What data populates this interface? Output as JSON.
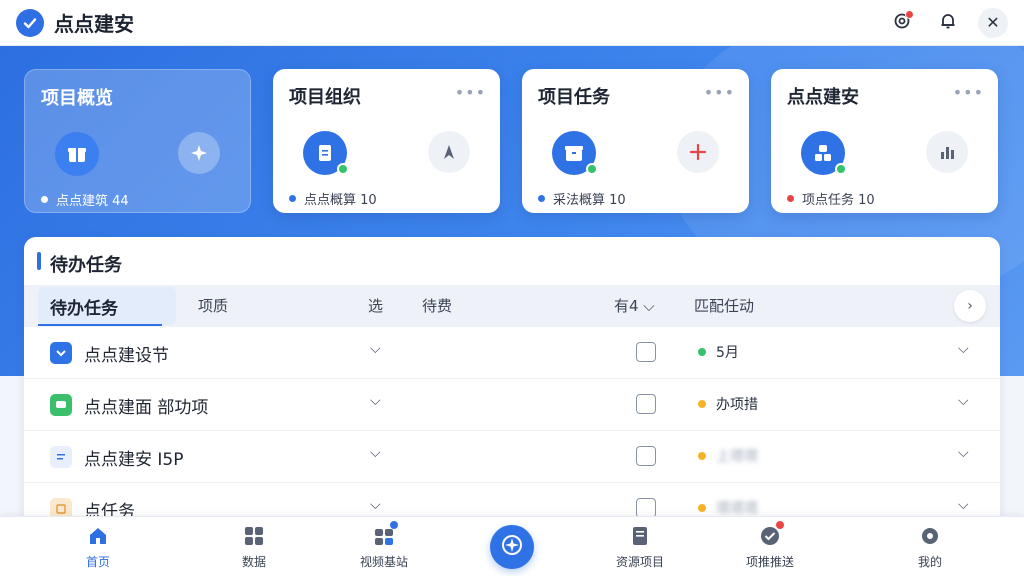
{
  "header": {
    "app_title": "点点建安",
    "settings_icon": "gear-icon",
    "bell_icon": "bell-icon",
    "close_label": "✕"
  },
  "cards": [
    {
      "title": "项目概览",
      "main_icon": "gift-icon",
      "side_icon": "sparkle-icon",
      "stat_text": "点点建筑 44",
      "stat_color": "#ffffff",
      "active": true
    },
    {
      "title": "项目组织",
      "main_icon": "document-icon",
      "side_icon": "navigation-icon",
      "stat_text": "点点概算 10",
      "stat_color": "#2f72e6",
      "more": "•••"
    },
    {
      "title": "项目任务",
      "main_icon": "task-box-icon",
      "side_icon": "plus-icon",
      "stat_text": "采法概算 10",
      "stat_color": "#2f72e6",
      "more": "•••"
    },
    {
      "title": "点点建安",
      "main_icon": "user-group-icon",
      "side_icon": "bar-chart-icon",
      "stat_text": "项点任务 10",
      "stat_color": "#e84545",
      "more": "•••"
    }
  ],
  "panel": {
    "title": "待办任务",
    "columns": {
      "tab": "待办任务",
      "c1": "项质",
      "c2": "选",
      "c3": "待费",
      "c4": "有4 ⌵",
      "c5": "匹配任动"
    },
    "rows": [
      {
        "name": "点点建设节",
        "icon_color": "#2f72e6",
        "status_text": "5月",
        "status_color": "#34c26a",
        "blurred": false
      },
      {
        "name": "点点建面 部功项",
        "icon_color": "#3cbf6a",
        "status_text": "办项措",
        "status_color": "#f5b428",
        "blurred": false
      },
      {
        "name": "点点建安 I5P",
        "icon_color": "#e8eefc",
        "status_text": "上项项",
        "status_color": "#f5b428",
        "blurred": true
      },
      {
        "name": "点任务",
        "icon_color": "#fbe9cf",
        "status_text": "项项项",
        "status_color": "#f5b428",
        "blurred": true
      }
    ]
  },
  "bottom_nav": [
    {
      "label": "首页",
      "icon": "home-icon",
      "active": true
    },
    {
      "label": "数据",
      "icon": "grid-icon"
    },
    {
      "label": "视频基站",
      "icon": "apps-icon"
    },
    {
      "label": "",
      "icon": "compass-icon"
    },
    {
      "label": "资源项目",
      "icon": "notebook-icon"
    },
    {
      "label": "项推推送",
      "icon": "check-circle-icon"
    },
    {
      "label": "我的",
      "icon": "profile-icon"
    }
  ]
}
